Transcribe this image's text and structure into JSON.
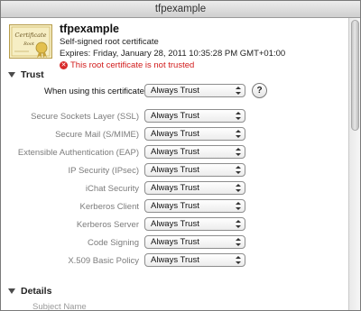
{
  "window": {
    "title": "tfpexample"
  },
  "certificate": {
    "name": "tfpexample",
    "type": "Self-signed root certificate",
    "expires": "Expires: Friday, January 28, 2011 10:35:28 PM GMT+01:00",
    "warning": "This root certificate is not trusted",
    "icon": "certificate-icon",
    "icon_text": [
      "Certificate",
      "Root"
    ]
  },
  "trust": {
    "header": "Trust",
    "when_using_label": "When using this certificate:",
    "when_using_value": "Always Trust",
    "settings": [
      {
        "label": "Secure Sockets Layer (SSL)",
        "value": "Always Trust"
      },
      {
        "label": "Secure Mail (S/MIME)",
        "value": "Always Trust"
      },
      {
        "label": "Extensible Authentication (EAP)",
        "value": "Always Trust"
      },
      {
        "label": "IP Security (IPsec)",
        "value": "Always Trust"
      },
      {
        "label": "iChat Security",
        "value": "Always Trust"
      },
      {
        "label": "Kerberos Client",
        "value": "Always Trust"
      },
      {
        "label": "Kerberos Server",
        "value": "Always Trust"
      },
      {
        "label": "Code Signing",
        "value": "Always Trust"
      },
      {
        "label": "X.509 Basic Policy",
        "value": "Always Trust"
      }
    ],
    "help_label": "?"
  },
  "details": {
    "header": "Details",
    "first_field": "Subject Name"
  },
  "colors": {
    "warning": "#d11a1a",
    "muted_label": "#7c7c7c"
  }
}
